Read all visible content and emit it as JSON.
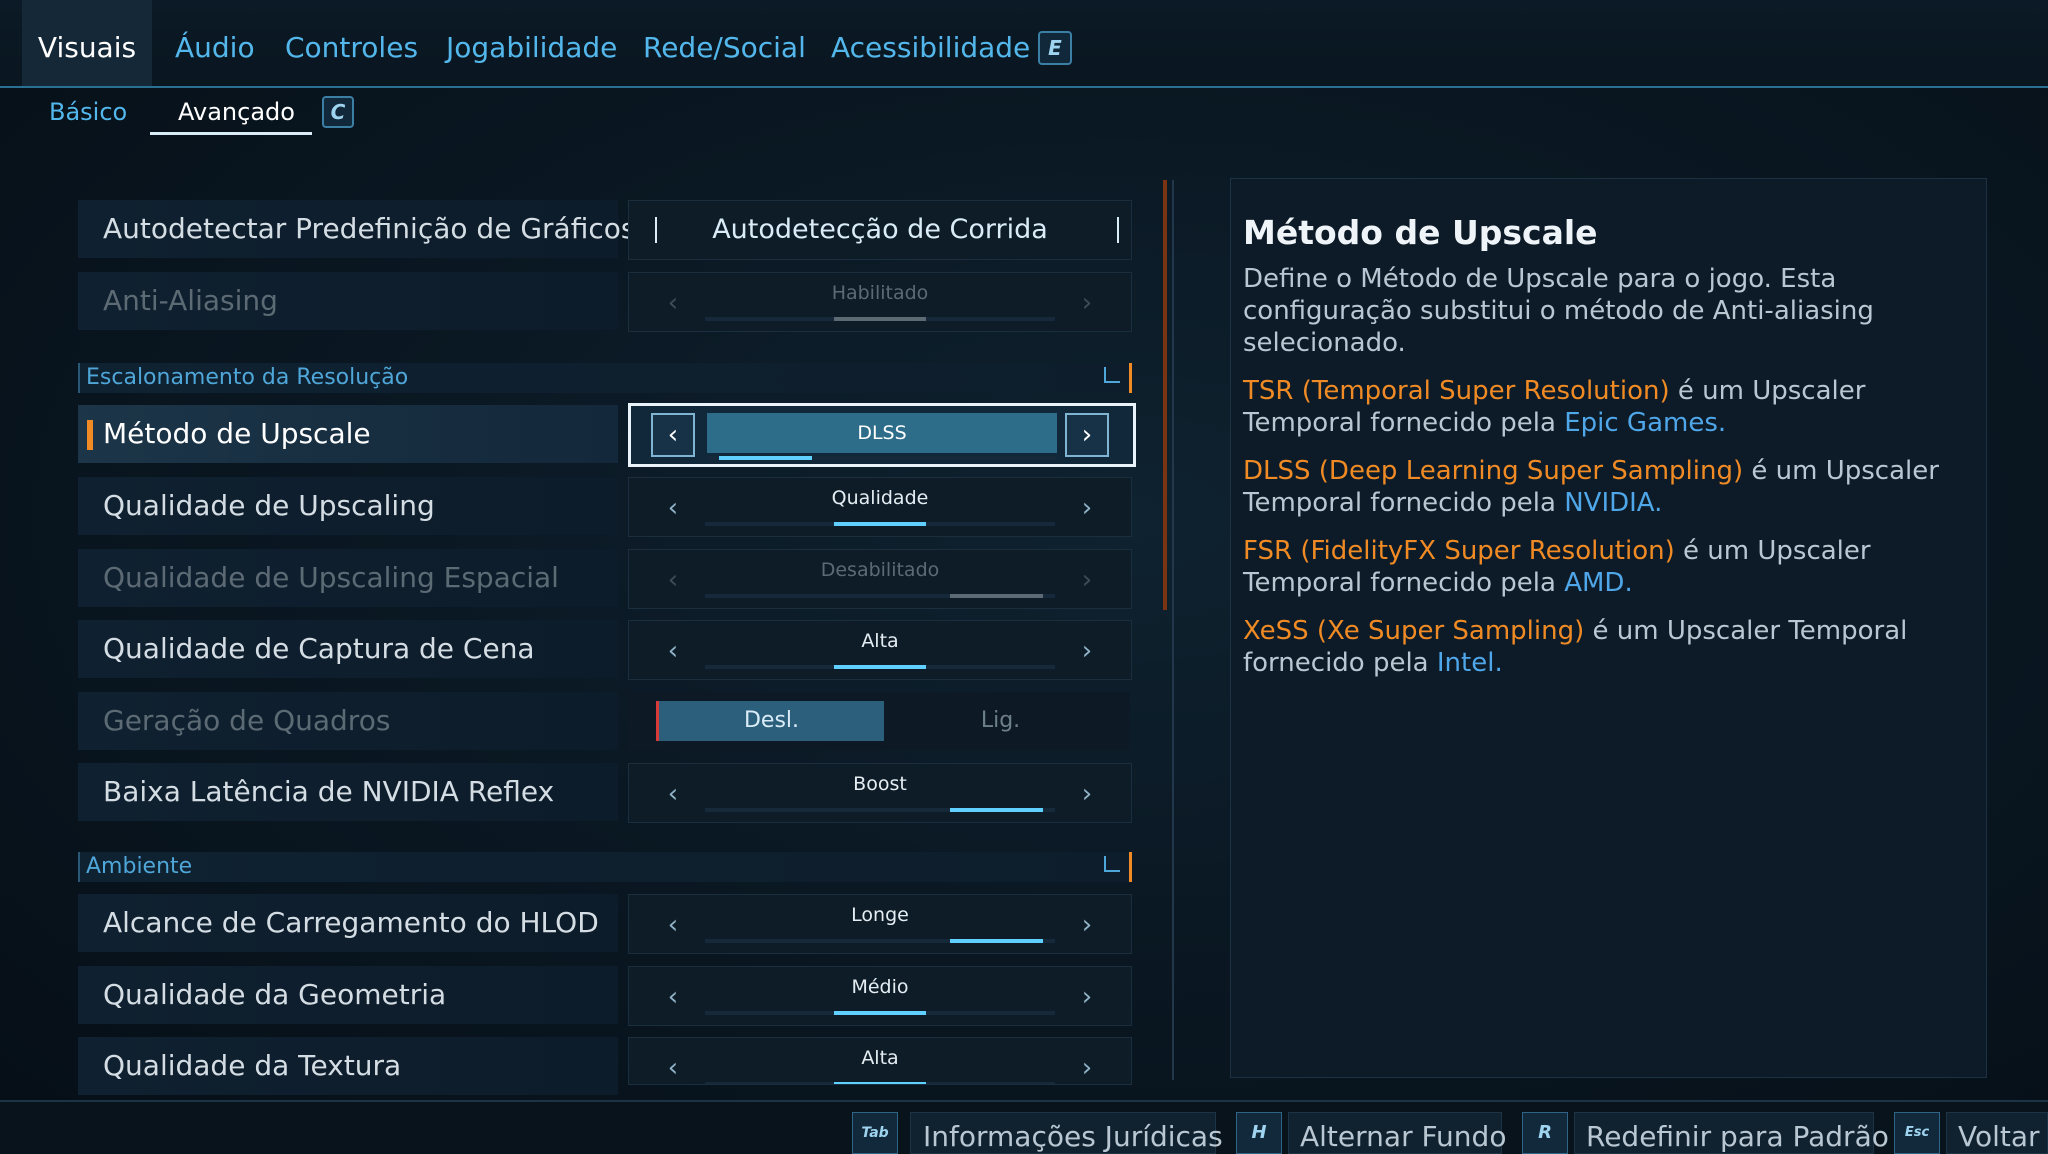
{
  "tabs": {
    "items": [
      "Visuais",
      "Áudio",
      "Controles",
      "Jogabilidade",
      "Rede/Social",
      "Acessibilidade"
    ],
    "next_key": "E"
  },
  "subtabs": {
    "items": [
      "Básico",
      "Avançado"
    ],
    "next_key": "C"
  },
  "settings": {
    "autodetect": {
      "label": "Autodetectar Predefinição de Gráficos",
      "value": "Autodetecção de Corrida"
    },
    "antialiasing": {
      "label": "Anti-Aliasing",
      "value": "Habilitado",
      "level": 0.67
    },
    "section_resolution": "Escalonamento da Resolução",
    "upscale_method": {
      "label": "Método de Upscale",
      "value": "DLSS",
      "level": 0.33
    },
    "upscaling_quality": {
      "label": "Qualidade de Upscaling",
      "value": "Qualidade",
      "level": 0.67
    },
    "spatial_quality": {
      "label": "Qualidade de Upscaling Espacial",
      "value": "Desabilitado",
      "level": 1.0
    },
    "scene_capture": {
      "label": "Qualidade de Captura de Cena",
      "value": "Alta",
      "level": 0.5
    },
    "frame_gen": {
      "label": "Geração de Quadros",
      "off": "Desl.",
      "on": "Lig."
    },
    "reflex": {
      "label": "Baixa Latência de NVIDIA Reflex",
      "value": "Boost",
      "level": 1.0
    },
    "section_environment": "Ambiente",
    "hlod_range": {
      "label": "Alcance de Carregamento do HLOD",
      "value": "Longe",
      "level": 1.0
    },
    "geometry": {
      "label": "Qualidade da Geometria",
      "value": "Médio",
      "level": 0.5
    },
    "texture": {
      "label": "Qualidade da Textura",
      "value": "Alta",
      "level": 0.5
    }
  },
  "info": {
    "title": "Método de Upscale",
    "description": "Define o Método de Upscale para o jogo. Esta configuração substitui o método de Anti-aliasing selecionado.",
    "tsr_name": "TSR (Temporal Super Resolution)",
    "tsr_text": " é um Upscaler Temporal fornecido pela ",
    "tsr_vendor": "Epic Games.",
    "dlss_name": "DLSS (Deep Learning Super Sampling)",
    "dlss_text": " é um Upscaler Temporal fornecido pela ",
    "dlss_vendor": "NVIDIA.",
    "fsr_name": "FSR (FidelityFX Super Resolution)",
    "fsr_text": " é um Upscaler Temporal fornecido pela ",
    "fsr_vendor": "AMD.",
    "xess_name": "XeSS (Xe Super Sampling)",
    "xess_text": " é um Upscaler Temporal fornecido pela ",
    "xess_vendor": "Intel."
  },
  "footer": [
    {
      "key": "Tab",
      "label": "Informações Jurídicas"
    },
    {
      "key": "H",
      "label": "Alternar Fundo"
    },
    {
      "key": "R",
      "label": "Redefinir para Padrão"
    },
    {
      "key": "Esc",
      "label": "Voltar"
    }
  ],
  "colors": {
    "accent": "#53b7ec",
    "highlight": "#f08a24",
    "fill": "#5fd0ff"
  },
  "icons": {
    "prev": "chevron-left-icon",
    "next": "chevron-right-icon"
  }
}
